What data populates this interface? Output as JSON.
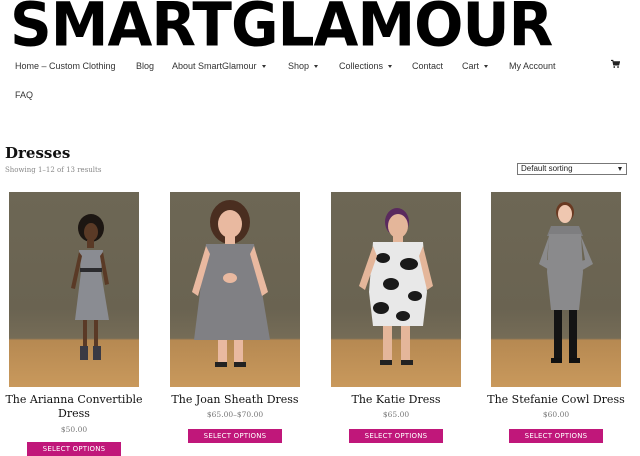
{
  "brand": {
    "logo_text": "SMARTGLAMOUR"
  },
  "nav": {
    "items": [
      {
        "label": "Home – Custom Clothing"
      },
      {
        "label": "Blog"
      },
      {
        "label": "About SmartGlamour"
      },
      {
        "label": "Shop"
      },
      {
        "label": "Collections"
      },
      {
        "label": "Contact"
      },
      {
        "label": "Cart"
      },
      {
        "label": "My Account"
      },
      {
        "label": "FAQ"
      }
    ],
    "cart_icon": "shopping-cart-icon"
  },
  "page": {
    "title": "Dresses",
    "result_count": "Showing 1–12 of 13 results",
    "sort_selected": "Default sorting"
  },
  "products": [
    {
      "name": "The Arianna Convertible Dress",
      "price": "$50.00",
      "button": "SELECT OPTIONS",
      "dress_color": "#8a8c92"
    },
    {
      "name": "The Joan Sheath Dress",
      "price": "$65.00–$70.00",
      "button": "SELECT OPTIONS",
      "dress_color": "#808084"
    },
    {
      "name": "The Katie Dress",
      "price": "$65.00",
      "button": "SELECT OPTIONS",
      "dress_color": "#e8e8e8"
    },
    {
      "name": "The Stefanie Cowl Dress",
      "price": "$60.00",
      "button": "SELECT OPTIONS",
      "dress_color": "#8a8a8c"
    }
  ],
  "colors": {
    "accent": "#c0177a"
  }
}
